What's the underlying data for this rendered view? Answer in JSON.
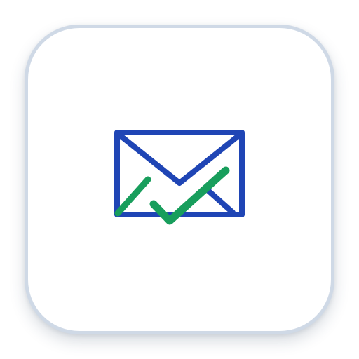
{
  "app_icon": {
    "icon": "mail-verified-icon",
    "tile_border_color": "#cfd9e6",
    "tile_background": "#ffffff",
    "envelope_color": "#1f45b5",
    "checkmark_color": "#189e5c"
  }
}
